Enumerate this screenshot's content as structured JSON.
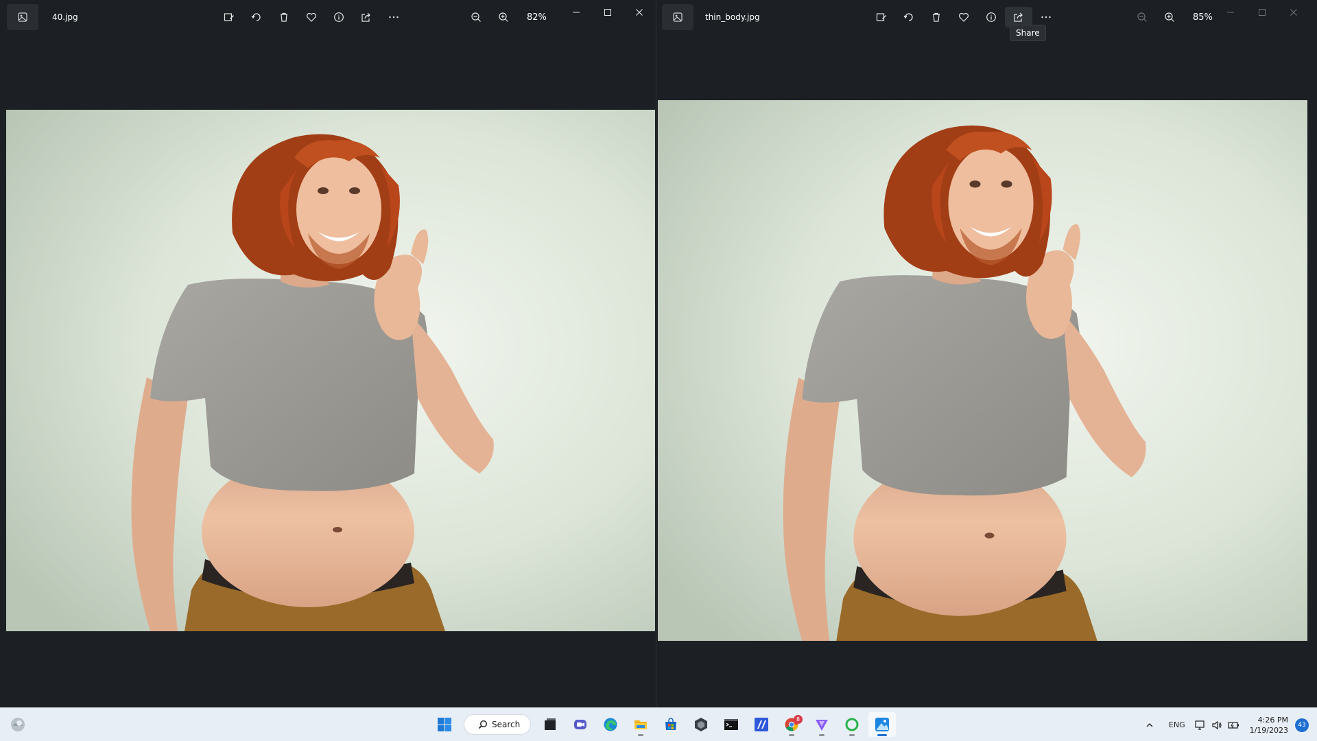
{
  "left_window": {
    "filename": "40.jpg",
    "zoom": "82%",
    "toolbar": [
      "edit-image-icon",
      "rotate-icon",
      "delete-icon",
      "favorite-icon",
      "info-icon",
      "share-icon",
      "more-icon"
    ]
  },
  "right_window": {
    "filename": "thin_body.jpg",
    "zoom": "85%",
    "tooltip": "Share"
  },
  "taskbar": {
    "search_label": "Search",
    "language": "ENG",
    "time": "4:26 PM",
    "date": "1/19/2023",
    "notification_count": "43",
    "chrome_badge": "8",
    "apps": [
      "start-icon",
      "search-box",
      "task-view-icon",
      "teams-icon",
      "edge-icon",
      "file-explorer-icon",
      "store-icon",
      "unity-icon",
      "terminal-icon",
      "visual-studio-icon",
      "chrome-icon",
      "vpn-icon",
      "circle-app-icon",
      "photos-icon"
    ]
  },
  "colors": {
    "window_bg": "#1c2024",
    "taskbar_bg": "#e8eef5",
    "accent": "#1f6fd1",
    "photo_bg": "#dfe6db",
    "hair": "#b5491c",
    "shirt": "#9c9a96",
    "skin": "#e2b596",
    "pants": "#9a6a2a"
  }
}
